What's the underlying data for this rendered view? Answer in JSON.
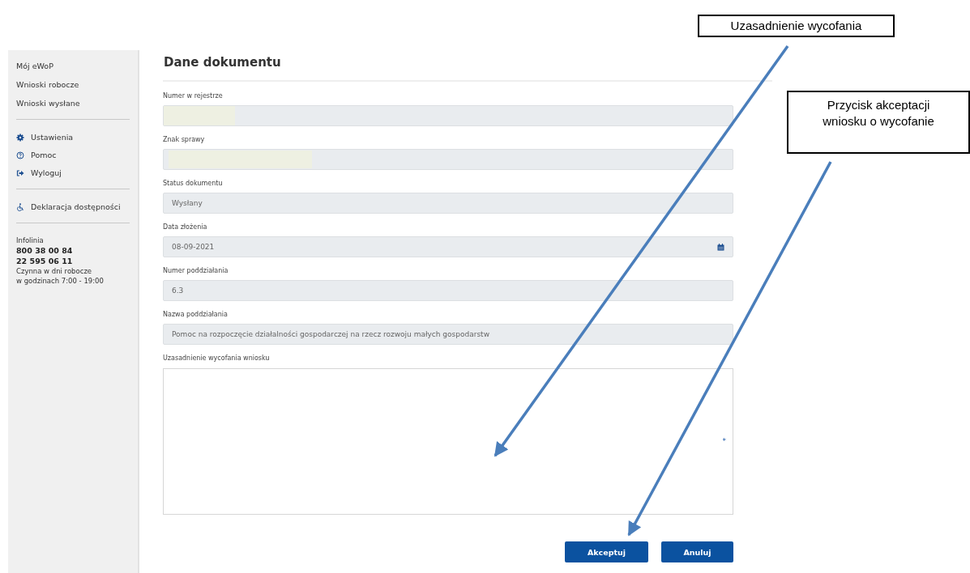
{
  "sidebar": {
    "nav": [
      {
        "label": "Mój eWoP"
      },
      {
        "label": "Wnioski robocze"
      },
      {
        "label": "Wnioski wysłane"
      }
    ],
    "actions": [
      {
        "label": "Ustawienia",
        "kind": "gear"
      },
      {
        "label": "Pomoc",
        "kind": "help"
      },
      {
        "label": "Wyloguj",
        "kind": "logout"
      }
    ],
    "accessibility": {
      "label": "Deklaracja dostępności"
    },
    "hotline": {
      "title": "Infolinia",
      "phones": [
        "800 38 00 84",
        "22 595 06 11"
      ],
      "hours": [
        "Czynna w dni robocze",
        "w godzinach 7:00 - 19:00"
      ]
    }
  },
  "form": {
    "title": "Dane dokumentu",
    "fields": [
      {
        "label": "Numer w rejestrze",
        "kind": "redacted"
      },
      {
        "label": "Znak sprawy",
        "kind": "redacted"
      },
      {
        "label": "Status dokumentu",
        "kind": "text",
        "value": "Wysłany"
      },
      {
        "label": "Data złożenia",
        "kind": "date",
        "value": "08-09-2021"
      },
      {
        "label": "Numer poddziałania",
        "kind": "text",
        "value": "6.3"
      },
      {
        "label": "Nazwa poddziałania",
        "kind": "text",
        "value": "Pomoc na rozpoczęcie działalności gospodarczej na rzecz rozwoju małych gospodarstw"
      }
    ],
    "justification": {
      "label": "Uzasadnienie wycofania wniosku",
      "required_mark": "*"
    },
    "buttons": [
      "Akceptuj",
      "Anuluj"
    ]
  },
  "callouts": [
    {
      "text": "Uzasadnienie wycofania"
    },
    {
      "text": "Przycisk akceptacji wniosku o wycofanie"
    }
  ]
}
